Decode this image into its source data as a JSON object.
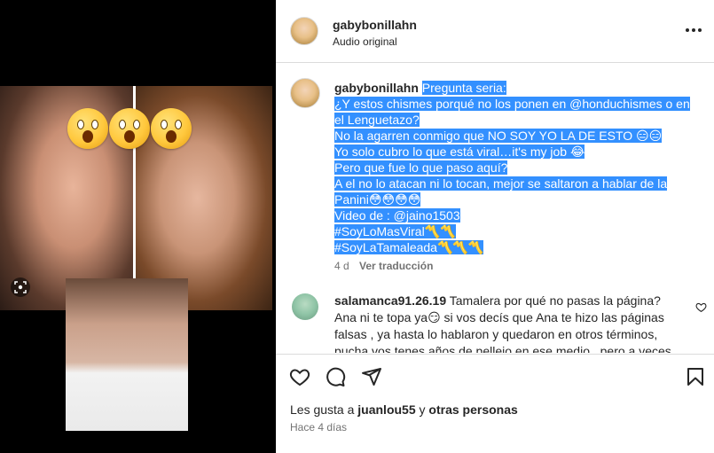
{
  "post": {
    "username": "gabybonillahn",
    "audio": "Audio original"
  },
  "caption": {
    "username": "gabybonillahn",
    "lines": [
      "Pregunta seria:",
      "¿Y estos chismes porqué no los ponen en @honduchismes o en el Lenguetazo?",
      "No la agarren conmigo que NO SOY YO LA DE ESTO 😑😑",
      "Yo solo cubro lo que está viral…it's my job 😂",
      "Pero que fue lo que paso aquí?",
      "A el no lo atacan ni lo tocan, mejor se saltaron a hablar de la Panini😳😳😳😳",
      "Video de : @jaino1503",
      "#SoyLoMasViral〽️〽️",
      "#SoyLaTamaleada〽️〽️〽️"
    ],
    "age": "4 d",
    "translate": "Ver traducción"
  },
  "comment": {
    "username": "salamanca91.26.19",
    "text": "Tamalera por qué no pasas la página? Ana ni te topa ya😏 si vos decís que Ana te hizo las páginas falsas , ya hasta lo hablaron y quedaron en otros términos, pucha vos tenes años de pellejo en ese medio , pero a veces siento que"
  },
  "footer": {
    "likes_prefix": "Les gusta a ",
    "likes_user": "juanlou55",
    "likes_mid": " y ",
    "likes_others": "otras personas",
    "time": "Hace 4 días"
  },
  "icons": {
    "like": "heart-icon",
    "comment": "comment-icon",
    "share": "share-icon",
    "save": "bookmark-icon",
    "more": "more-options-icon",
    "scan": "visual-search-icon"
  },
  "colors": {
    "selection": "#3390ff",
    "muted": "#737373",
    "border": "#dbdbdb"
  }
}
